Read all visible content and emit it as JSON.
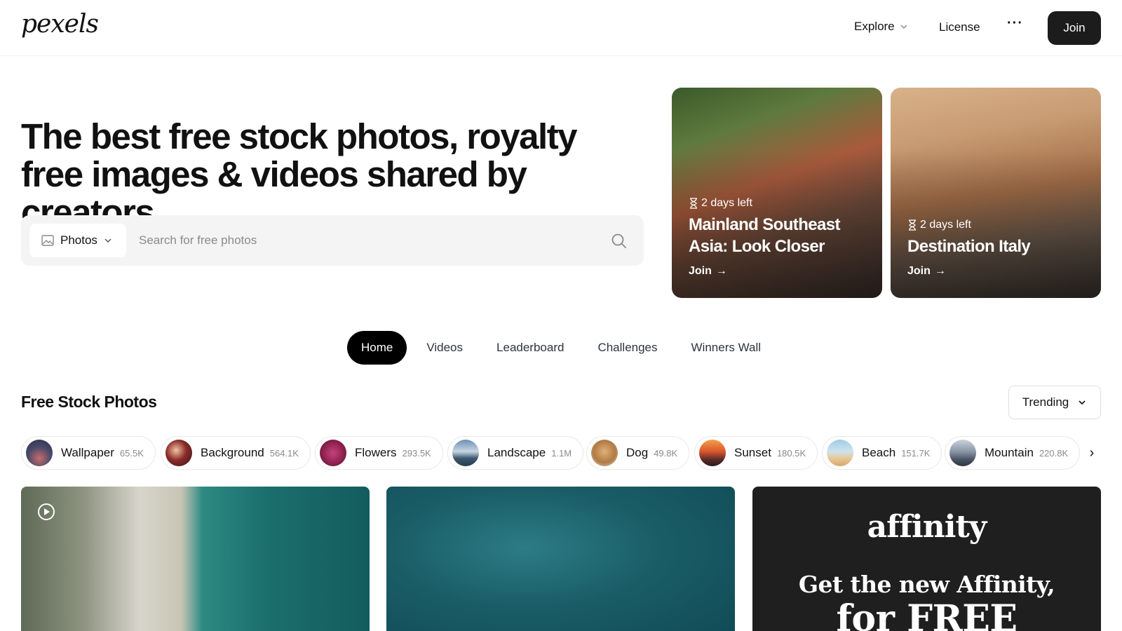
{
  "header": {
    "logo": "pexels",
    "nav": {
      "explore": "Explore",
      "license": "License",
      "more": "···"
    },
    "join_label": "Join"
  },
  "hero": {
    "title": "The best free stock photos, royalty free images & videos shared by creators.",
    "search": {
      "type_label": "Photos",
      "placeholder": "Search for free photos"
    }
  },
  "challenges": [
    {
      "time_left": "2 days left",
      "title": "Mainland Southeast Asia: Look Closer",
      "cta": "Join"
    },
    {
      "time_left": "2 days left",
      "title": "Destination Italy",
      "cta": "Join"
    }
  ],
  "tabs": [
    {
      "label": "Home",
      "active": true
    },
    {
      "label": "Videos"
    },
    {
      "label": "Leaderboard"
    },
    {
      "label": "Challenges"
    },
    {
      "label": "Winners Wall"
    }
  ],
  "section": {
    "title": "Free Stock Photos",
    "sort_label": "Trending"
  },
  "chips": [
    {
      "label": "Wallpaper",
      "count": "65.5K"
    },
    {
      "label": "Background",
      "count": "564.1K"
    },
    {
      "label": "Flowers",
      "count": "293.5K"
    },
    {
      "label": "Landscape",
      "count": "1.1M"
    },
    {
      "label": "Dog",
      "count": "49.8K"
    },
    {
      "label": "Sunset",
      "count": "180.5K"
    },
    {
      "label": "Beach",
      "count": "151.7K"
    },
    {
      "label": "Mountain",
      "count": "220.8K"
    }
  ],
  "ad": {
    "brand": "affinity",
    "line1": "Get the new Affinity,",
    "line2": "for FREE"
  },
  "colors": {
    "accent": "#1c1c1c",
    "text": "#111111",
    "muted": "#8a8a8a",
    "search_bg": "#f4f4f4"
  }
}
